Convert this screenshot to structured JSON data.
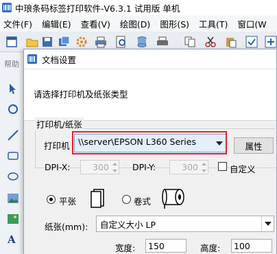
{
  "app": {
    "title": "中琅条码标签打印软件-V6.3.1 试用版 单机"
  },
  "menu": [
    "文件(F)",
    "编辑(E)",
    "查看(V)",
    "绘图(D)",
    "图形(S)",
    "工具(T)",
    "窗口(W"
  ],
  "left_tool_label": "帮助",
  "dialog": {
    "title": "文档设置",
    "instruction": "请选择打印机及纸张类型",
    "printer_group": "打印机/纸张",
    "printer_label": "打印机",
    "printer_value": "\\\\server\\EPSON L360 Series",
    "properties_button": "属性",
    "dpi_x_label": "DPI-X:",
    "dpi_x_value": "300",
    "dpi_y_label": "DPI-Y:",
    "dpi_y_value": "300",
    "custom_label": "自定义",
    "flat_sheet_label": "平张",
    "roll_label": "卷式",
    "paper_label": "纸张(mm):",
    "paper_value": "自定义大小 LP",
    "width_label": "宽度:",
    "width_value": "150",
    "height_label": "高度:",
    "height_value": "100"
  },
  "colors": {
    "highlight": "#e5232b",
    "select_bg": "#e5eefb"
  }
}
